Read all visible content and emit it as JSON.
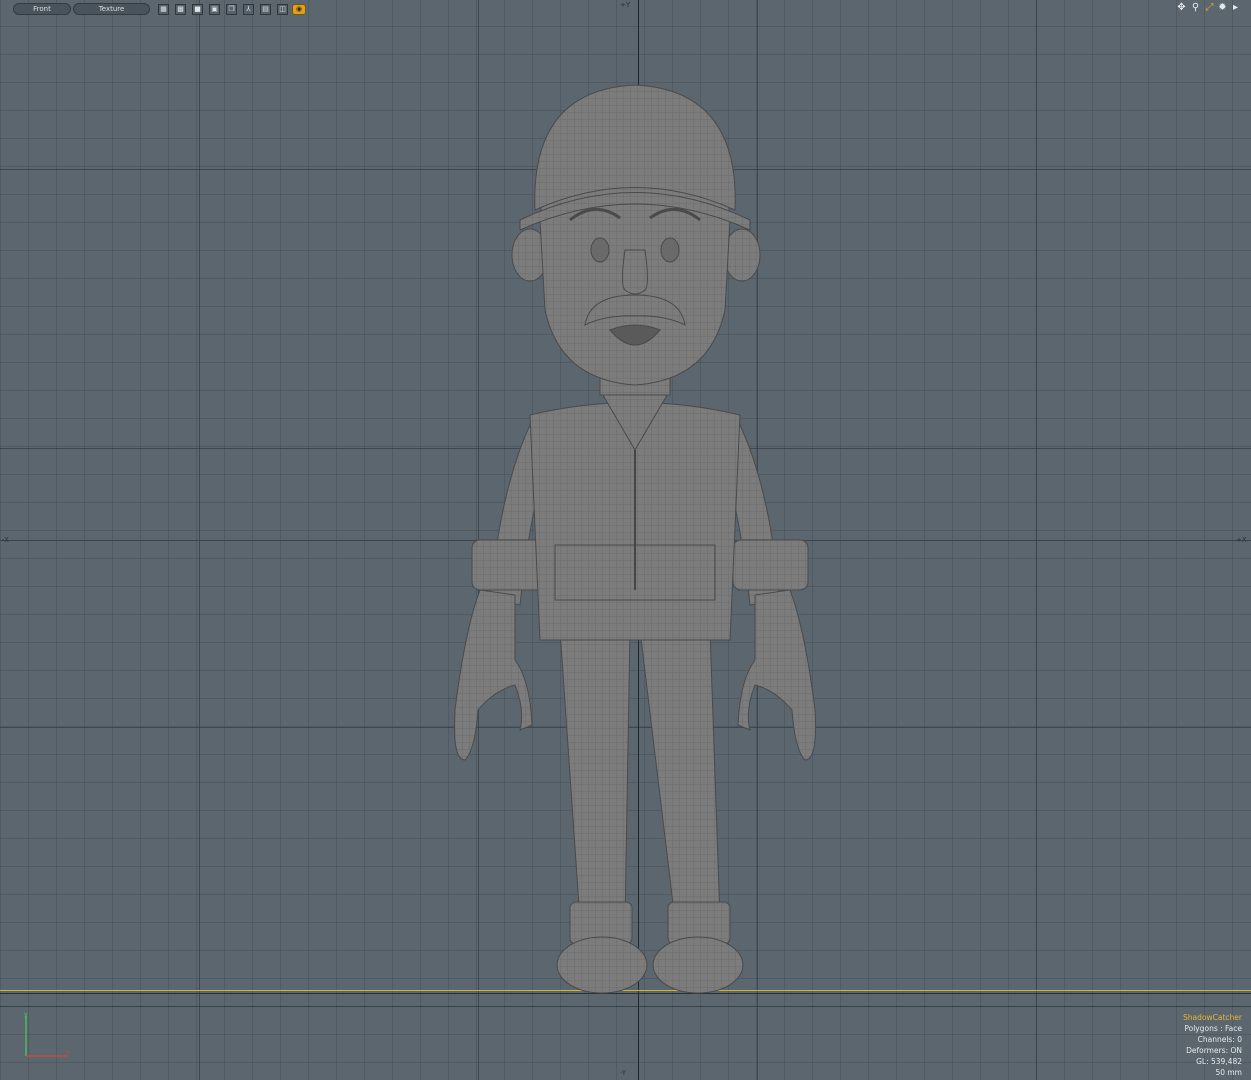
{
  "viewport": {
    "view_label": "Front",
    "shading_label": "Texture",
    "axis_labels": {
      "top": "+Y",
      "bottom": "-Y",
      "left": "-X",
      "right": "+X"
    },
    "toolbar_icons": [
      "grid-icon",
      "wireframe-icon",
      "solid-icon",
      "backdrop-icon",
      "layers-icon",
      "axis-icon",
      "lock-icon",
      "visibility-icon",
      "render-icon"
    ],
    "nav_icons": [
      "pan-icon",
      "zoom-icon",
      "fit-icon",
      "settings-icon",
      "expand-icon"
    ]
  },
  "info": {
    "title": "ShadowCatcher",
    "polygons": "Polygons : Face",
    "channels": "Channels: 0",
    "deformers": "Deformers: ON",
    "gl": "GL: 539,482",
    "lens": "50 mm"
  },
  "colors": {
    "background": "#5b666f",
    "accent": "#e0b020",
    "info_title": "#e8b53a"
  }
}
